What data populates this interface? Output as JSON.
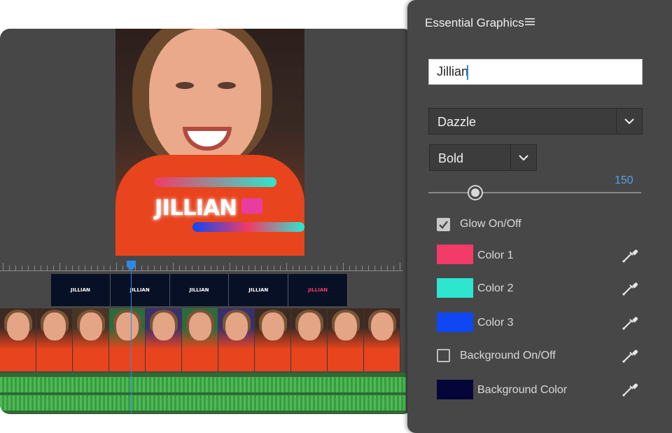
{
  "preview": {
    "title_text": "JILLIAN"
  },
  "title_track": {
    "clips": [
      "JILLIAN",
      "JILLIAN",
      "JILLIAN",
      "JILLIAN",
      "JILLIAN"
    ]
  },
  "panel": {
    "title": "Essential Graphics",
    "menu_icon": "hamburger-icon",
    "text_value": "Jillian",
    "font": "Dazzle",
    "weight": "Bold",
    "size_value": "150",
    "size_slider_fraction": 0.22,
    "glow_label": "Glow On/Off",
    "glow_checked": true,
    "colors": [
      {
        "label": "Color 1",
        "hex": "#f23b67"
      },
      {
        "label": "Color 2",
        "hex": "#2ee6cf"
      },
      {
        "label": "Color 3",
        "hex": "#0f47f2"
      }
    ],
    "background_toggle_label": "Background On/Off",
    "background_checked": false,
    "background_color_label": "Background Color",
    "background_color_hex": "#05053a",
    "accent_color": "#2b8ae8"
  }
}
